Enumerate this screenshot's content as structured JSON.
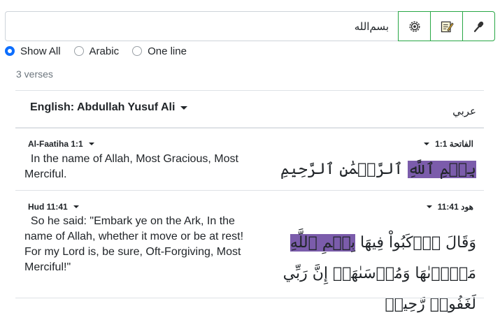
{
  "search": {
    "value": "بسم‌الله"
  },
  "toolbar": [
    {
      "name": "settings-button",
      "icon": "gear-icon"
    },
    {
      "name": "notes-button",
      "icon": "notepad-icon"
    },
    {
      "name": "voice-button",
      "icon": "microphone-icon"
    }
  ],
  "options": {
    "show_all": "Show All",
    "arabic": "Arabic",
    "one_line": "One line",
    "selected": "show_all"
  },
  "results": {
    "count_text": "3 verses"
  },
  "header": {
    "translation": "English: Abdullah Yusuf Ali",
    "arabic_label": "عربي"
  },
  "verses": [
    {
      "ref_en": "Al-Faatiha 1:1",
      "ref_ar": "الفاتحة 1:1",
      "translation": "In the name of Allah, Most Gracious, Most Merciful.",
      "arabic_before": "",
      "arabic_highlight": "بِسۡمِ ٱللَّهِ",
      "arabic_after": " ٱلرَّحۡمَٰنِ ٱلرَّحِيمِ"
    },
    {
      "ref_en": "Hud 11:41",
      "ref_ar": "هود 11:41",
      "translation": "So he said: \"Embark ye on the Ark, In the name of Allah, whether it move or be at rest! For my Lord is, be sure, Oft-Forgiving, Most Merciful!\"",
      "arabic_before": "وَقَالَ ٱرۡكَبُواْ فِيهَا ",
      "arabic_highlight": "بِسۡمِ ٱللَّهِ",
      "arabic_after": " مَجۡرٜىٰهَا وَمُرۡسَىٰهَآۚ إِنَّ رَبِّي لَغَفُورٞ رَّحِيمٞ"
    }
  ],
  "colors": {
    "accent_green": "#28a745",
    "radio_blue": "#0d6efd",
    "highlight": "#7b5cab"
  }
}
